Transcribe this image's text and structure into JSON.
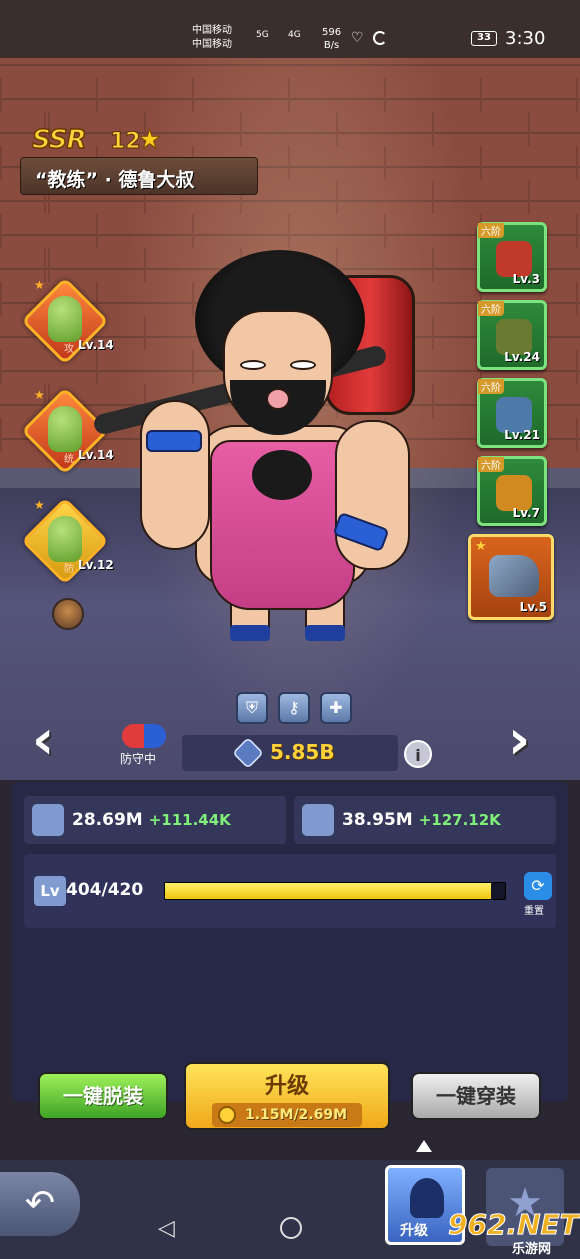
{
  "status_bar": {
    "carrier1": "中国移动",
    "carrier2": "中国移动",
    "sig1": "5G",
    "sig2": "4G",
    "net_speed_value": "596",
    "net_speed_unit": "B/s",
    "battery": "33",
    "time": "3:30"
  },
  "hero": {
    "rarity": "SSR",
    "stars": "12",
    "star_icon": "star-icon",
    "name": "“教练” · 德鲁大叔"
  },
  "skills": [
    {
      "level": "Lv.14",
      "tag": "攻"
    },
    {
      "level": "Lv.14",
      "tag": "统"
    },
    {
      "level": "Lv.12",
      "tag": "防"
    }
  ],
  "equipment": [
    {
      "rank": "六阶",
      "level": "Lv.3",
      "color": "#c0392b"
    },
    {
      "rank": "六阶",
      "level": "Lv.24",
      "color": "#6a7a30"
    },
    {
      "rank": "六阶",
      "level": "Lv.21",
      "color": "#4d7aa8"
    },
    {
      "rank": "六阶",
      "level": "Lv.7",
      "color": "#d08a20"
    },
    {
      "rank": "",
      "level": "Lv.5",
      "color": "#6b84a8"
    }
  ],
  "status": {
    "defend_text": "防守中",
    "power_value": "5.85B"
  },
  "stats": {
    "attack_value": "28.69M",
    "attack_increase": "+111.44K",
    "health_value": "38.95M",
    "health_increase": "+127.12K"
  },
  "level": {
    "badge": "Lv",
    "current": "404/420",
    "progress": 0.96,
    "reset_label": "重置"
  },
  "buttons": {
    "unequip_all": "一键脱装",
    "upgrade": "升级",
    "upgrade_cost": "1.15M/2.69M",
    "equip_all": "一键穿装"
  },
  "bottom_nav": {
    "upgrade_tab": "升级"
  },
  "watermark": {
    "big": "962.NET",
    "small": "乐游网"
  },
  "colors": {
    "accent_gold": "#ffd23a",
    "increase_green": "#7ff07a",
    "panel_bg": "#262845"
  }
}
